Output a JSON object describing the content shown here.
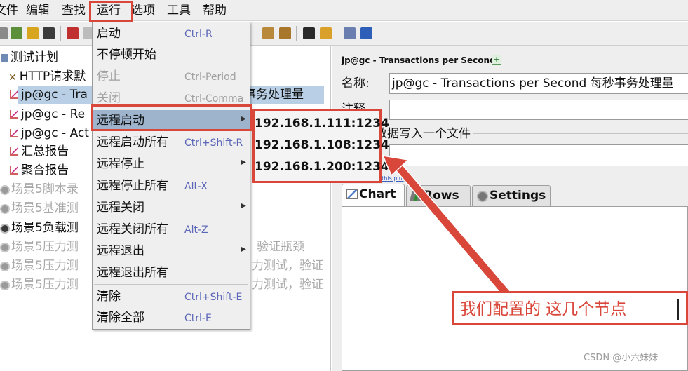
{
  "menubar": {
    "items": [
      "文件",
      "编辑",
      "查找",
      "运行",
      "选项",
      "工具",
      "帮助"
    ],
    "file_visible": "文件"
  },
  "tree": {
    "items": [
      {
        "label": "测试计划",
        "icon": "test-plan-icon",
        "state": "normal"
      },
      {
        "label": "HTTP请求默",
        "icon": "tools-icon",
        "state": "normal"
      },
      {
        "label": "jp@gc - Tra",
        "suffix": "事务处理量",
        "icon": "graph-icon",
        "state": "selected"
      },
      {
        "label": "jp@gc - Re",
        "icon": "graph-icon",
        "state": "normal"
      },
      {
        "label": "jp@gc - Act",
        "icon": "graph-icon",
        "state": "normal"
      },
      {
        "label": "汇总报告",
        "icon": "graph-icon",
        "state": "normal"
      },
      {
        "label": "聚合报告",
        "icon": "graph-icon",
        "state": "normal"
      },
      {
        "label": "场景5脚本录",
        "icon": "gear-icon",
        "state": "disabled"
      },
      {
        "label": "场景5基准测",
        "icon": "gear-icon",
        "state": "disabled"
      },
      {
        "label": "场景5负载测",
        "icon": "eye-icon",
        "state": "normal"
      },
      {
        "label": "场景5压力测",
        "suffix": "验证瓶颈",
        "icon": "gear-icon",
        "state": "disabled"
      },
      {
        "label": "场景5压力测",
        "suffix": "力测试，验证",
        "icon": "gear-icon",
        "state": "disabled"
      },
      {
        "label": "场景5压力测",
        "suffix": "力测试，验证",
        "icon": "gear-icon",
        "state": "disabled"
      }
    ]
  },
  "run_menu": {
    "items": [
      {
        "label": "启动",
        "shortcut": "Ctrl-R",
        "disabled": false,
        "submenu": false
      },
      {
        "label": "不停顿开始",
        "shortcut": "",
        "disabled": false,
        "submenu": false
      },
      {
        "label": "停止",
        "shortcut": "Ctrl-Period",
        "disabled": true,
        "submenu": false
      },
      {
        "label": "关闭",
        "shortcut": "Ctrl-Comma",
        "disabled": true,
        "submenu": false
      },
      {
        "label": "远程启动",
        "shortcut": "",
        "disabled": false,
        "submenu": true,
        "highlighted": true
      },
      {
        "label": "远程启动所有",
        "shortcut": "Ctrl+Shift-R",
        "disabled": false,
        "submenu": false
      },
      {
        "label": "远程停止",
        "shortcut": "",
        "disabled": false,
        "submenu": true
      },
      {
        "label": "远程停止所有",
        "shortcut": "Alt-X",
        "disabled": false,
        "submenu": false
      },
      {
        "label": "远程关闭",
        "shortcut": "",
        "disabled": false,
        "submenu": true
      },
      {
        "label": "远程关闭所有",
        "shortcut": "Alt-Z",
        "disabled": false,
        "submenu": false
      },
      {
        "label": "远程退出",
        "shortcut": "",
        "disabled": false,
        "submenu": true
      },
      {
        "label": "远程退出所有",
        "shortcut": "",
        "disabled": false,
        "submenu": false
      },
      {
        "label": "清除",
        "shortcut": "Ctrl+Shift-E",
        "disabled": false,
        "submenu": false
      },
      {
        "label": "清除全部",
        "shortcut": "Ctrl-E",
        "disabled": false,
        "submenu": false
      }
    ],
    "remote_hosts": [
      "192.168.1.111:1234",
      "192.168.1.108:1234",
      "192.168.1.200:1234"
    ]
  },
  "panel": {
    "title": "jp@gc - Transactions per Second",
    "name_label": "名称:",
    "name_value": "jp@gc - Transactions per Second 每秒事务处理量",
    "comment_label": "注释",
    "file_group_label": "数据写入一个文件",
    "help_link": "Help on this plugin",
    "tabs": [
      {
        "label": "Chart",
        "icon": "chart-icon",
        "active": true
      },
      {
        "label": "Rows",
        "icon": "rows-icon",
        "active": false
      },
      {
        "label": "Settings",
        "icon": "settings-icon",
        "active": false
      }
    ]
  },
  "annotation": {
    "callout_text": "我们配置的 这几个节点",
    "color": "#d9473a"
  },
  "watermark": "CSDN @小六妹妹"
}
